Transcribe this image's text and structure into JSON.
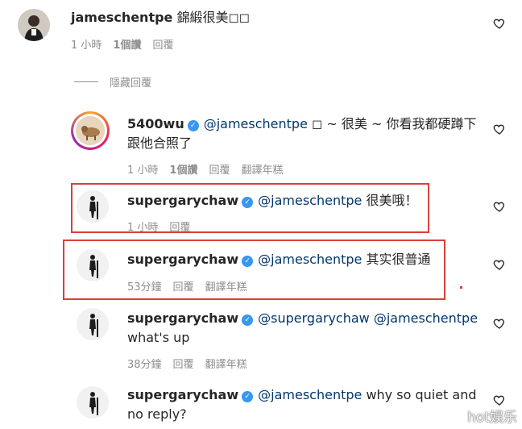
{
  "comments": [
    {
      "username": "jameschentpe",
      "text": "錦緞很美◻◻",
      "time": "1 小時",
      "likes": "1個讚",
      "reply": "回覆"
    },
    {
      "username": "5400wu",
      "mention": "@jameschentpe",
      "text_line1": "◻ ~ 很美 ~ 你看我都硬蹲下",
      "text_line2": "跟他合照了",
      "time": "1 小時",
      "likes": "1個讚",
      "reply": "回覆",
      "translate": "翻譯年糕"
    },
    {
      "username": "supergarychaw",
      "mention": "@jameschentpe",
      "text": "很美哦！",
      "time": "1 小時",
      "reply": "回覆"
    },
    {
      "username": "supergarychaw",
      "mention": "@jameschentpe",
      "text": "其实很普通",
      "time": "53分鐘",
      "reply": "回覆",
      "translate": "翻譯年糕"
    },
    {
      "username": "supergarychaw",
      "mention": "@supergarychaw @jameschentpe",
      "text_line2": "what's up",
      "time": "38分鐘",
      "reply": "回覆",
      "translate": "翻譯年糕"
    },
    {
      "username": "supergarychaw",
      "mention": "@jameschentpe",
      "text": "why so quiet and",
      "text_line2": "no reply?"
    }
  ],
  "hide_replies": "隱藏回覆",
  "verified_mark": "✓",
  "watermark": "hot娱乐",
  "colors": {
    "mention": "#00376b",
    "meta": "#8e8e8e",
    "highlight_box": "#d9403a",
    "verified": "#3897f0"
  },
  "icons": {
    "like": "heart-outline-icon",
    "verified": "verified-badge-icon"
  }
}
